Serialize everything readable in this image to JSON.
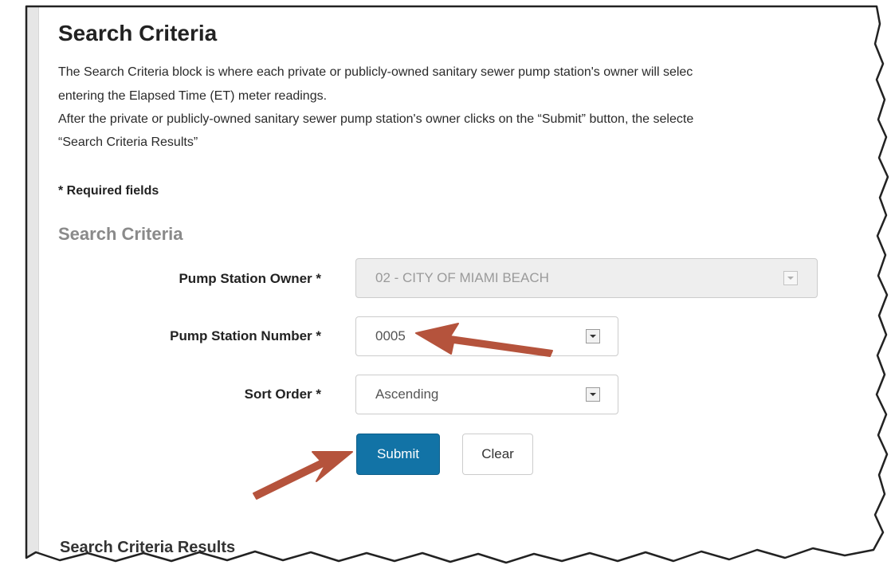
{
  "page": {
    "title": "Search Criteria",
    "description_lines": [
      "The Search Criteria block is where each private or publicly-owned sanitary sewer pump station's owner will selec",
      "entering the Elapsed Time (ET) meter readings.",
      "After the private or publicly-owned sanitary sewer pump station's owner clicks on the “Submit” button, the selecte",
      "“Search Criteria Results”"
    ],
    "required_note": "* Required fields"
  },
  "form": {
    "heading": "Search Criteria",
    "owner": {
      "label": "Pump Station Owner *",
      "value": "02 - CITY OF MIAMI BEACH",
      "disabled": true
    },
    "station_number": {
      "label": "Pump Station Number *",
      "value": "0005"
    },
    "sort_order": {
      "label": "Sort Order *",
      "value": "Ascending"
    },
    "submit_label": "Submit",
    "clear_label": "Clear"
  },
  "results": {
    "heading": "Search Criteria Results"
  },
  "colors": {
    "primary_button": "#1273a6",
    "annotation_arrow": "#b5533c",
    "section_heading": "#8a8a8a"
  },
  "icons": {
    "dropdown": "chevron-down-icon",
    "annotation": "arrow-icon"
  }
}
